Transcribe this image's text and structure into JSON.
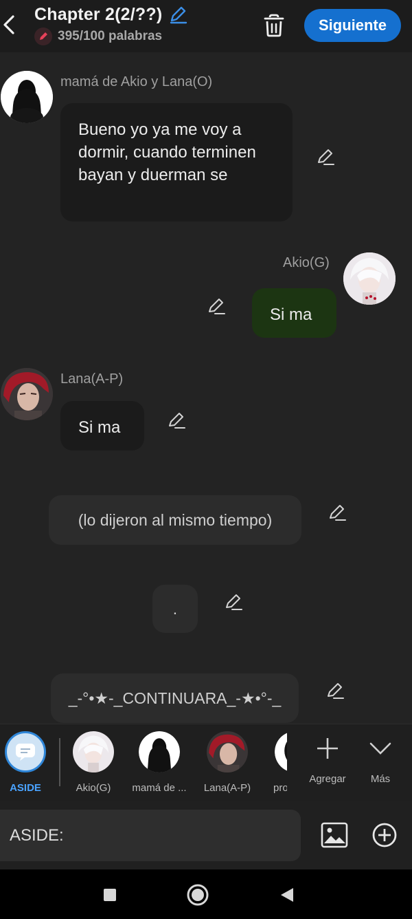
{
  "header": {
    "title": "Chapter 2(2/??)",
    "word_count": "395/100 palabras",
    "next_label": "Siguiente"
  },
  "messages": [
    {
      "speaker": "mamá de Akio y Lana(O)",
      "text": "Bueno yo ya me voy a dormir, cuando terminen bayan y duerman se"
    },
    {
      "speaker": "Akio(G)",
      "text": "Si ma"
    },
    {
      "speaker": "Lana(A-P)",
      "text": "Si ma"
    }
  ],
  "asides": [
    "(lo dijeron al mismo tiempo)",
    ".",
    "_-°•★-_CONTINUARA_-★•°-_"
  ],
  "characters": [
    {
      "name": "ASIDE"
    },
    {
      "name": "Akio(G)"
    },
    {
      "name": "mamá de ..."
    },
    {
      "name": "Lana(A-P)"
    },
    {
      "name": "pro"
    }
  ],
  "tools": {
    "add_label": "Agregar",
    "more_label": "Más"
  },
  "input": {
    "prefix": "ASIDE:"
  },
  "colors": {
    "accent": "#1570cf",
    "background": "#232323",
    "green_bubble": "#1c3512"
  }
}
